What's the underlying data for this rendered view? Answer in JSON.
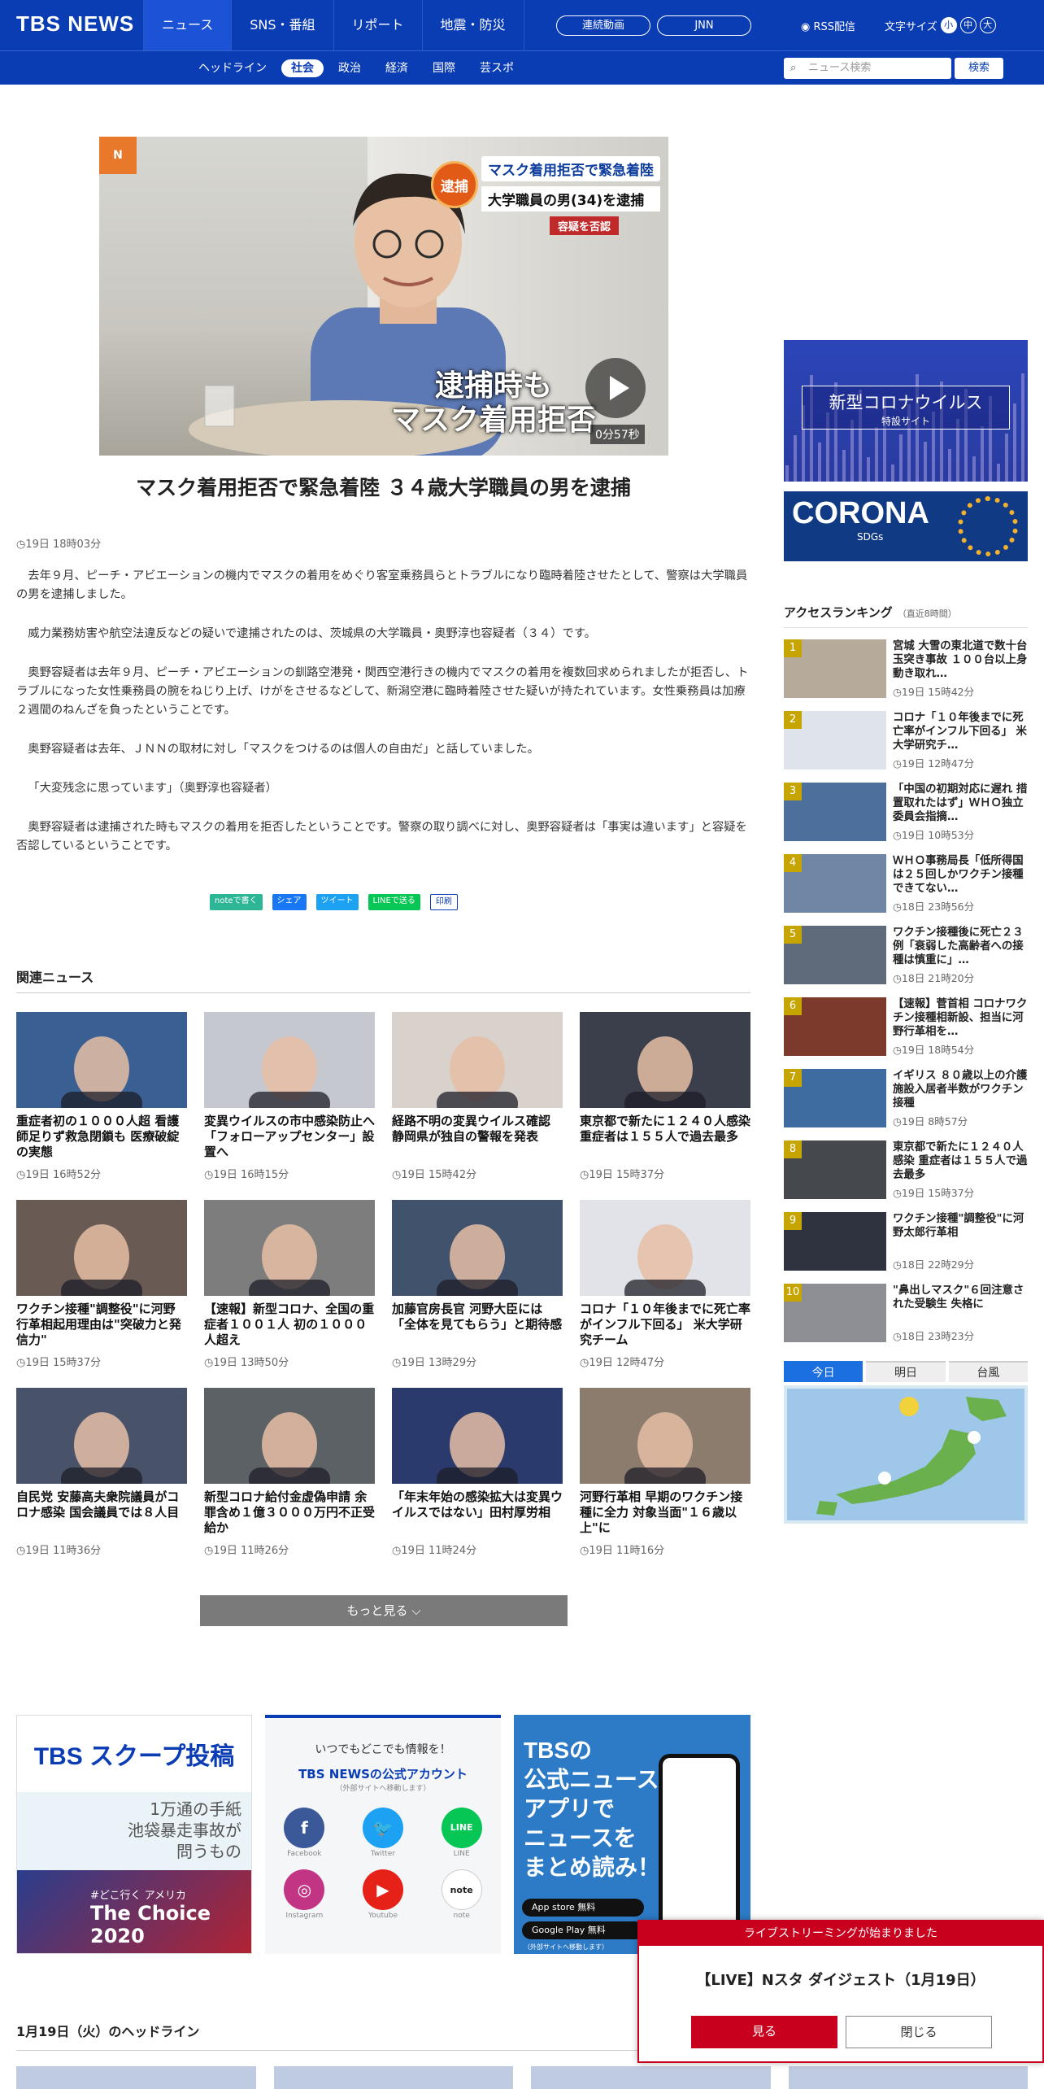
{
  "header": {
    "logo": "TBS NEWS",
    "nav": [
      "ニュース",
      "SNS・番組",
      "リポート",
      "地震・防災"
    ],
    "pills": [
      "連続動画",
      "JNN"
    ],
    "rss": "RSS配信",
    "font_size_label": "文字サイズ",
    "font_sizes": [
      "小",
      "中",
      "大"
    ]
  },
  "subnav": {
    "items": [
      "ヘッドライン",
      "社会",
      "政治",
      "経済",
      "国際",
      "芸スポ"
    ],
    "active": "社会",
    "search_placeholder": "ニュース検索",
    "search_button": "検索"
  },
  "article": {
    "video_overlay": {
      "badge": "逮捕",
      "tag_line1": "マスク着用拒否で緊急着陸",
      "tag_line2": "大学職員の男(34)を逮捕",
      "tag_line3": "容疑を否認",
      "caption_line1": "逮捕時も",
      "caption_line2": "マスク着用拒否",
      "duration": "0分57秒",
      "corner": "N"
    },
    "title": "マスク着用拒否で緊急着陸 ３４歳大学職員の男を逮捕",
    "time": "19日 18時03分",
    "paragraphs": [
      "去年９月、ピーチ・アビエーションの機内でマスクの着用をめぐり客室乗務員らとトラブルになり臨時着陸させたとして、警察は大学職員の男を逮捕しました。",
      "威力業務妨害や航空法違反などの疑いで逮捕されたのは、茨城県の大学職員・奥野淳也容疑者（３４）です。",
      "奥野容疑者は去年９月、ピーチ・アビエーションの釧路空港発・関西空港行きの機内でマスクの着用を複数回求められましたが拒否し、トラブルになった女性乗務員の腕をねじり上げ、けがをさせるなどして、新潟空港に臨時着陸させた疑いが持たれています。女性乗務員は加療２週間のねんざを負ったということです。",
      "奥野容疑者は去年、ＪＮＮの取材に対し「マスクをつけるのは個人の自由だ」と話していました。",
      "「大変残念に思っています」（奥野淳也容疑者）",
      "奥野容疑者は逮捕された時もマスクの着用を拒否したということです。警察の取り調べに対し、奥野容疑者は「事実は違います」と容疑を否認しているということです。"
    ],
    "share": [
      "noteで書く",
      "シェア",
      "ツイート",
      "LINEで送る",
      "印刷"
    ]
  },
  "related": {
    "title": "関連ニュース",
    "items": [
      {
        "title": "重症者初の１０００人超 看護師足りず救急閉鎖も 医療破綻の実態",
        "time": "19日 16時52分"
      },
      {
        "title": "変異ウイルスの市中感染防止へ「フォローアップセンター」設置へ",
        "time": "19日 16時15分"
      },
      {
        "title": "経路不明の変異ウイルス確認 静岡県が独自の警報を発表",
        "time": "19日 15時42分"
      },
      {
        "title": "東京都で新たに１２４０人感染 重症者は１５５人で過去最多",
        "time": "19日 15時37分"
      },
      {
        "title": "ワクチン接種\"調整役\"に河野行革相起用理由は\"突破力と発信力\"",
        "time": "19日 15時37分"
      },
      {
        "title": "【速報】新型コロナ、全国の重症者１００１人 初の１０００人超え",
        "time": "19日 13時50分"
      },
      {
        "title": "加藤官房長官 河野大臣には「全体を見てもらう」と期待感",
        "time": "19日 13時29分"
      },
      {
        "title": "コロナ「１０年後までに死亡率がインフル下回る」 米大学研究チーム",
        "time": "19日 12時47分"
      },
      {
        "title": "自民党 安藤高夫衆院議員がコロナ感染 国会議員では８人目",
        "time": "19日 11時36分"
      },
      {
        "title": "新型コロナ給付金虚偽申請 余罪含め１億３０００万円不正受給か",
        "time": "19日 11時26分"
      },
      {
        "title": "「年末年始の感染拡大は変異ウイルスではない」田村厚労相",
        "time": "19日 11時24分"
      },
      {
        "title": "河野行革相 早期のワクチン接種に全力 対象当面\"１６歳以上\"に",
        "time": "19日 11時16分"
      }
    ],
    "thumb_colors": [
      "#3a5f93",
      "#c6c8cf",
      "#d8d1cc",
      "#3b3f4c",
      "#6a5a54",
      "#7d7d7d",
      "#41526d",
      "#e1e3e8",
      "#48536a",
      "#5c6166",
      "#2a3a6d",
      "#8b7c6e"
    ],
    "more": "もっと見る"
  },
  "banners": {
    "scoop": "TBS スクープ投稿",
    "scoop_sub1": "1万通の手紙",
    "scoop_sub2": "池袋暴走事故が",
    "scoop_sub3": "問うもの",
    "choice": "The Choice 2020",
    "choice_sub": "#どこ行く アメリカ",
    "social_head": "いつでもどこでも情報を！",
    "social_title": "TBS NEWSの公式アカウント",
    "social_note": "（外部サイトへ移動します）",
    "social": [
      "Facebook",
      "Twitter",
      "LINE",
      "Instagram",
      "Youtube",
      "note"
    ],
    "app_lines": [
      "TBSの",
      "公式ニュース",
      "アプリで",
      "ニュースを",
      "まとめ読み！"
    ],
    "app_store": "App store 無料",
    "google_play": "Google Play 無料",
    "app_note": "（外部サイトへ移動します）"
  },
  "headline_date": "1月19日（火）のヘッドライン",
  "sidebar": {
    "corona_title": "新型コロナウイルス",
    "corona_sub": "特設サイト",
    "corona2": "CORONA",
    "corona2_sub": "SDGs",
    "ranking_title": "アクセスランキング",
    "ranking_sub": "（直近8時間）",
    "ranking": [
      {
        "no": "1",
        "title": "宮城 大雪の東北道で数十台玉突き事故 １００台以上身動き取れ…",
        "time": "19日 15時42分"
      },
      {
        "no": "2",
        "title": "コロナ「１０年後までに死亡率がインフル下回る」 米大学研究チ…",
        "time": "19日 12時47分"
      },
      {
        "no": "3",
        "title": "「中国の初期対応に遅れ 措置取れたはず」ＷＨＯ独立委員会指摘…",
        "time": "19日 10時53分"
      },
      {
        "no": "4",
        "title": "ＷＨＯ事務局長「低所得国は２５回しかワクチン接種できてない…",
        "time": "18日 23時56分"
      },
      {
        "no": "5",
        "title": "ワクチン接種後に死亡２３例「衰弱した高齢者への接種は慎重に」…",
        "time": "18日 21時20分"
      },
      {
        "no": "6",
        "title": "【速報】菅首相 コロナワクチン接種相新設、担当に河野行革相を…",
        "time": "19日 18時54分"
      },
      {
        "no": "7",
        "title": "イギリス ８０歳以上の介護施設入居者半数がワクチン接種",
        "time": "19日 8時57分"
      },
      {
        "no": "8",
        "title": "東京都で新たに１２４０人感染 重症者は１５５人で過去最多",
        "time": "19日 15時37分"
      },
      {
        "no": "9",
        "title": "ワクチン接種\"調整役\"に河野太郎行革相",
        "time": "18日 22時29分"
      },
      {
        "no": "10",
        "title": "\"鼻出しマスク\"６回注意された受験生 失格に",
        "time": "18日 23時23分"
      }
    ],
    "rank_colors": [
      "#b6aa9a",
      "#dfe3ea",
      "#4d6f9b",
      "#6f87a5",
      "#5f6a7a",
      "#7c3a2c",
      "#3e6ba0",
      "#45484c",
      "#2f3340",
      "#8e8f94"
    ],
    "weather_tabs": [
      "今日",
      "明日",
      "台風"
    ]
  },
  "popup": {
    "header": "ライブストリーミングが始まりました",
    "title": "【LIVE】Nスタ ダイジェスト（1月19日）",
    "watch": "見る",
    "close": "閉じる"
  }
}
